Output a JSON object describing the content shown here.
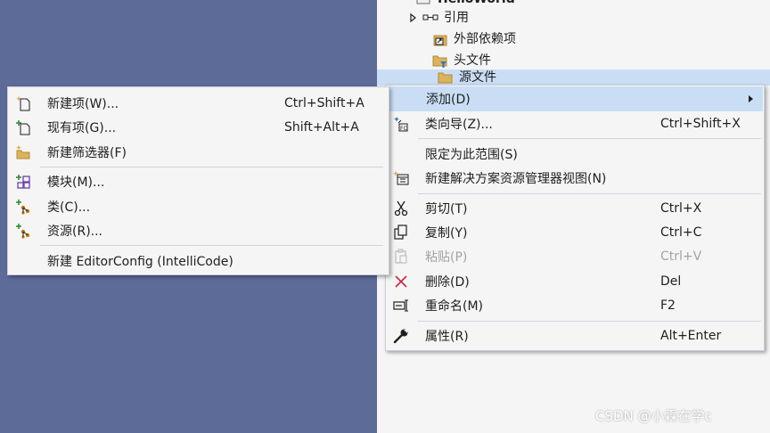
{
  "explorer": {
    "project_title": "HelloWorld",
    "items": [
      {
        "label": "引用",
        "icon": "references-icon"
      },
      {
        "label": "外部依赖项",
        "icon": "external-dependencies-icon"
      },
      {
        "label": "头文件",
        "icon": "header-filter-folder-icon"
      },
      {
        "label": "源文件",
        "icon": "source-folder-icon"
      }
    ]
  },
  "main_menu": {
    "items": [
      {
        "label": "添加(D)",
        "shortcut": "",
        "icon": "",
        "submenu": true,
        "highlighted": true
      },
      {
        "label": "类向导(Z)...",
        "shortcut": "Ctrl+Shift+X",
        "icon": "class-wizard-icon"
      },
      {
        "label": "限定为此范围(S)",
        "shortcut": "",
        "icon": ""
      },
      {
        "label": "新建解决方案资源管理器视图(N)",
        "shortcut": "",
        "icon": "new-explorer-view-icon"
      },
      {
        "label": "剪切(T)",
        "shortcut": "Ctrl+X",
        "icon": "cut-icon"
      },
      {
        "label": "复制(Y)",
        "shortcut": "Ctrl+C",
        "icon": "copy-icon"
      },
      {
        "label": "粘贴(P)",
        "shortcut": "Ctrl+V",
        "icon": "paste-icon",
        "disabled": true
      },
      {
        "label": "删除(D)",
        "shortcut": "Del",
        "icon": "delete-icon"
      },
      {
        "label": "重命名(M)",
        "shortcut": "F2",
        "icon": "rename-icon"
      },
      {
        "label": "属性(R)",
        "shortcut": "Alt+Enter",
        "icon": "properties-wrench-icon"
      }
    ]
  },
  "sub_menu": {
    "items": [
      {
        "label": "新建项(W)...",
        "shortcut": "Ctrl+Shift+A",
        "icon": "new-item-icon"
      },
      {
        "label": "现有项(G)...",
        "shortcut": "Shift+Alt+A",
        "icon": "existing-item-icon"
      },
      {
        "label": "新建筛选器(F)",
        "shortcut": "",
        "icon": "new-filter-icon"
      },
      {
        "label": "模块(M)...",
        "shortcut": "",
        "icon": "module-icon"
      },
      {
        "label": "类(C)...",
        "shortcut": "",
        "icon": "class-icon"
      },
      {
        "label": "资源(R)...",
        "shortcut": "",
        "icon": "resource-icon"
      },
      {
        "label": "新建 EditorConfig (IntelliCode)",
        "shortcut": "",
        "icon": ""
      }
    ]
  },
  "watermark": "CSDN @小霖在学c",
  "colors": {
    "desktop": "#5d6b99",
    "menu_bg": "#f5f5f5",
    "highlight": "#c9def5",
    "disabled_text": "#a2a4a5"
  }
}
